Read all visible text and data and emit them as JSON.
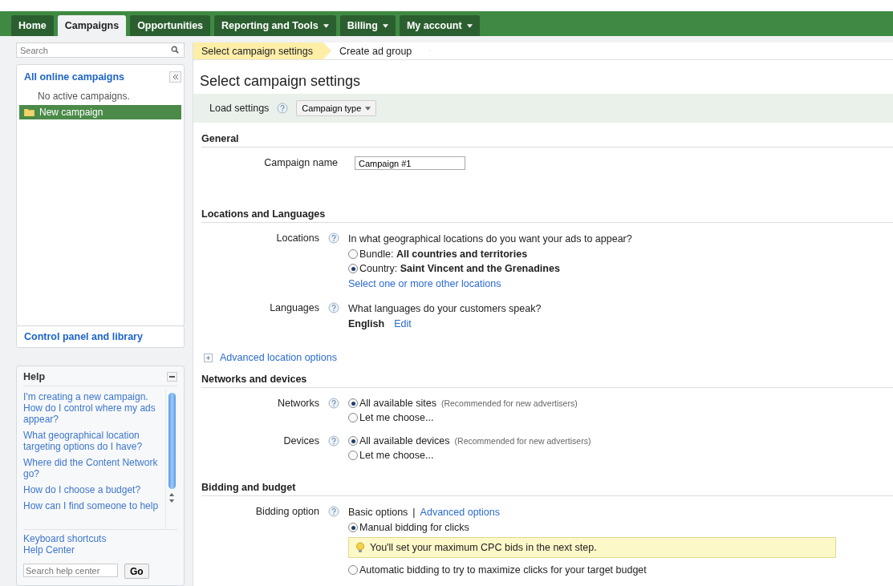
{
  "tabs": [
    {
      "label": "Home",
      "dropdown": false,
      "selected": false
    },
    {
      "label": "Campaigns",
      "dropdown": false,
      "selected": true
    },
    {
      "label": "Opportunities",
      "dropdown": false,
      "selected": false
    },
    {
      "label": "Reporting and Tools",
      "dropdown": true,
      "selected": false
    },
    {
      "label": "Billing",
      "dropdown": true,
      "selected": false
    },
    {
      "label": "My account",
      "dropdown": true,
      "selected": false
    }
  ],
  "sidebar": {
    "search": {
      "placeholder": "Search"
    },
    "heading": "All online campaigns",
    "empty_note": "No active campaigns.",
    "items": [
      {
        "label": "New campaign",
        "selected": true
      }
    ],
    "footer_link": "Control panel and library"
  },
  "help": {
    "title": "Help",
    "links": [
      "I'm creating a new campaign. How do I control where my ads appear?",
      "What geographical location targeting options do I have?",
      "Where did the Content Network go?",
      "How do I choose a budget?",
      "How can I find someone to help"
    ],
    "footer_links": [
      "Keyboard shortcuts",
      "Help Center"
    ],
    "search": {
      "placeholder": "Search help center"
    },
    "go_button": "Go"
  },
  "steps": [
    {
      "label": "Select campaign settings",
      "selected": true
    },
    {
      "label": "Create ad group",
      "selected": false
    }
  ],
  "page_title": "Select campaign settings",
  "load_settings": {
    "label": "Load settings",
    "dropdown": "Campaign type"
  },
  "sections": [
    {
      "title": "General",
      "fields": [
        {
          "label": "Campaign name",
          "help": false,
          "lines": [
            {
              "kind": "input",
              "value": "Campaign #1"
            }
          ]
        }
      ]
    },
    {
      "title": "Locations and Languages",
      "fields": [
        {
          "label": "Locations",
          "help": true,
          "lines": [
            {
              "kind": "text",
              "text": "In what geographical locations do you want your ads to appear?"
            },
            {
              "kind": "radio",
              "text": "Bundle: **All countries and territories**",
              "selected": false
            },
            {
              "kind": "radio",
              "text": "Country: **Saint Vincent and the Grenadines**",
              "selected": true
            },
            {
              "kind": "link",
              "text": "Select one or more other locations"
            }
          ]
        },
        {
          "label": "Languages",
          "help": true,
          "lines": [
            {
              "kind": "text",
              "text": "What languages do your customers speak?"
            },
            {
              "kind": "value_link",
              "value": "English",
              "link": "Edit"
            }
          ]
        }
      ],
      "expander": "Advanced location options"
    },
    {
      "title": "Networks and devices",
      "fields": [
        {
          "label": "Networks",
          "help": true,
          "lines": [
            {
              "kind": "radio",
              "text": "All available sites",
              "note": "(Recommended for new advertisers)",
              "selected": true
            },
            {
              "kind": "radio",
              "text": "Let me choose...",
              "selected": false
            }
          ]
        },
        {
          "label": "Devices",
          "help": true,
          "lines": [
            {
              "kind": "radio",
              "text": "All available devices",
              "note": "(Recommended for new advertisers)",
              "selected": true
            },
            {
              "kind": "radio",
              "text": "Let me choose...",
              "selected": false
            }
          ]
        }
      ]
    },
    {
      "title": "Bidding and budget",
      "fields": [
        {
          "label": "Bidding option",
          "help": true,
          "lines": [
            {
              "kind": "option_links",
              "current": "Basic options",
              "separator": "|",
              "link": "Advanced options"
            },
            {
              "kind": "radio",
              "text": "Manual bidding for clicks",
              "selected": true
            },
            {
              "kind": "tip",
              "text": "You'll set your maximum CPC bids in the next step."
            },
            {
              "kind": "radio",
              "text": "Automatic bidding to try to maximize clicks for your target budget",
              "selected": false
            }
          ]
        }
      ]
    }
  ]
}
